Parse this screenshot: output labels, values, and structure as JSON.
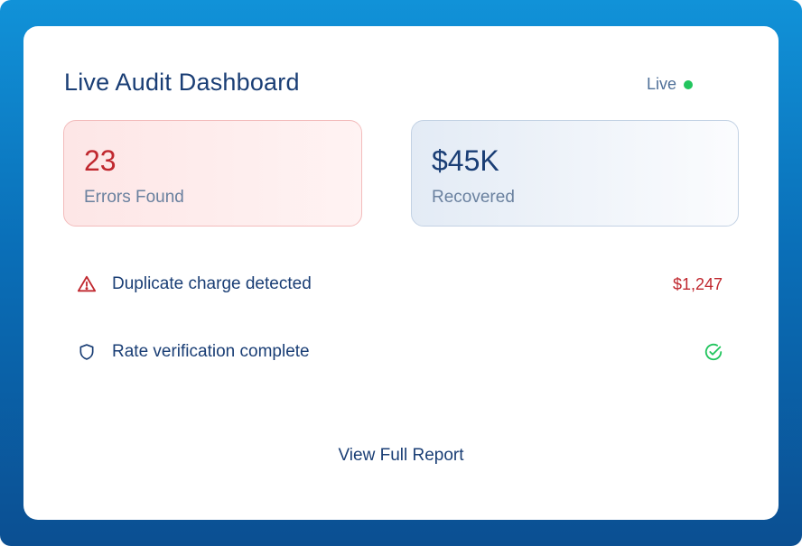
{
  "dashboard": {
    "title": "Live Audit Dashboard",
    "status_label": "Live",
    "status_color": "#22c55e"
  },
  "stats": {
    "errors": {
      "value": "23",
      "label": "Errors Found"
    },
    "recovered": {
      "value": "$45K",
      "label": "Recovered"
    }
  },
  "activity": [
    {
      "icon": "warning-triangle-icon",
      "text": "Duplicate charge detected",
      "amount": "$1,247"
    },
    {
      "icon": "shield-icon",
      "text": "Rate verification complete",
      "status_icon": "check-circle-icon"
    }
  ],
  "footer": {
    "report_link": "View Full Report"
  },
  "colors": {
    "primary_text": "#1a3e75",
    "error": "#c0282f",
    "success": "#22c55e",
    "background_top": "#1192d8",
    "background_bottom": "#0b4f92"
  }
}
